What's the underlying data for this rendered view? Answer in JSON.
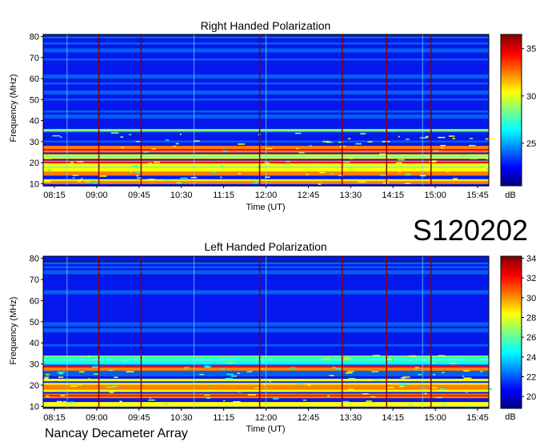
{
  "chart_data": [
    {
      "type": "heatmap",
      "title": "Right Handed Polarization",
      "xlabel": "Time (UT)",
      "ylabel": "Frequency (MHz)",
      "x_ticks": [
        "08:15",
        "09:00",
        "09:45",
        "10:30",
        "11:15",
        "12:00",
        "12:45",
        "13:30",
        "14:15",
        "15:00",
        "15:45"
      ],
      "y_ticks": [
        10,
        20,
        30,
        40,
        50,
        60,
        70,
        80
      ],
      "ylim": [
        9,
        81
      ],
      "colorbar_unit": "dB",
      "colorbar_ticks": [
        25,
        30,
        35
      ],
      "colorbar_range": [
        20.5,
        36.5
      ],
      "colormap": [
        "#00007f",
        "#0000ff",
        "#007fff",
        "#00ffff",
        "#7fff7f",
        "#ffff00",
        "#ff7f00",
        "#ff0000",
        "#7f0000"
      ],
      "bands_mhz": [
        {
          "low": 10,
          "high": 12,
          "level": 0.85
        },
        {
          "low": 14,
          "high": 16,
          "level": 0.95
        },
        {
          "low": 16,
          "high": 19,
          "level": 0.75
        },
        {
          "low": 19,
          "high": 21,
          "level": 0.9
        },
        {
          "low": 22,
          "high": 24,
          "level": 0.7
        },
        {
          "low": 25,
          "high": 28,
          "level": 0.95
        },
        {
          "low": 35,
          "high": 36,
          "level": 0.7
        }
      ]
    },
    {
      "type": "heatmap",
      "title": "Left Handed Polarization",
      "xlabel": "Time (UT)",
      "ylabel": "Frequency (MHz)",
      "x_ticks": [
        "08:15",
        "09:00",
        "09:45",
        "10:30",
        "11:15",
        "12:00",
        "12:45",
        "13:30",
        "14:15",
        "15:00",
        "15:45"
      ],
      "y_ticks": [
        10,
        20,
        30,
        40,
        50,
        60,
        70,
        80
      ],
      "ylim": [
        9,
        81
      ],
      "colorbar_unit": "dB",
      "colorbar_ticks": [
        20,
        22,
        24,
        26,
        28,
        30,
        32,
        34
      ],
      "colorbar_range": [
        18.8,
        34.2
      ],
      "colormap": [
        "#00007f",
        "#0000ff",
        "#007fff",
        "#00ffff",
        "#7fff7f",
        "#ffff00",
        "#ff7f00",
        "#ff0000",
        "#7f0000"
      ],
      "bands_mhz": [
        {
          "low": 10,
          "high": 12,
          "level": 0.8
        },
        {
          "low": 14,
          "high": 16,
          "level": 0.95
        },
        {
          "low": 17,
          "high": 21,
          "level": 0.9
        },
        {
          "low": 22,
          "high": 23,
          "level": 0.7
        },
        {
          "low": 27,
          "high": 29,
          "level": 0.95
        },
        {
          "low": 30,
          "high": 34,
          "level": 0.6
        }
      ]
    }
  ],
  "label": {
    "id": "S120202",
    "source": "Nancay Decameter Array"
  }
}
